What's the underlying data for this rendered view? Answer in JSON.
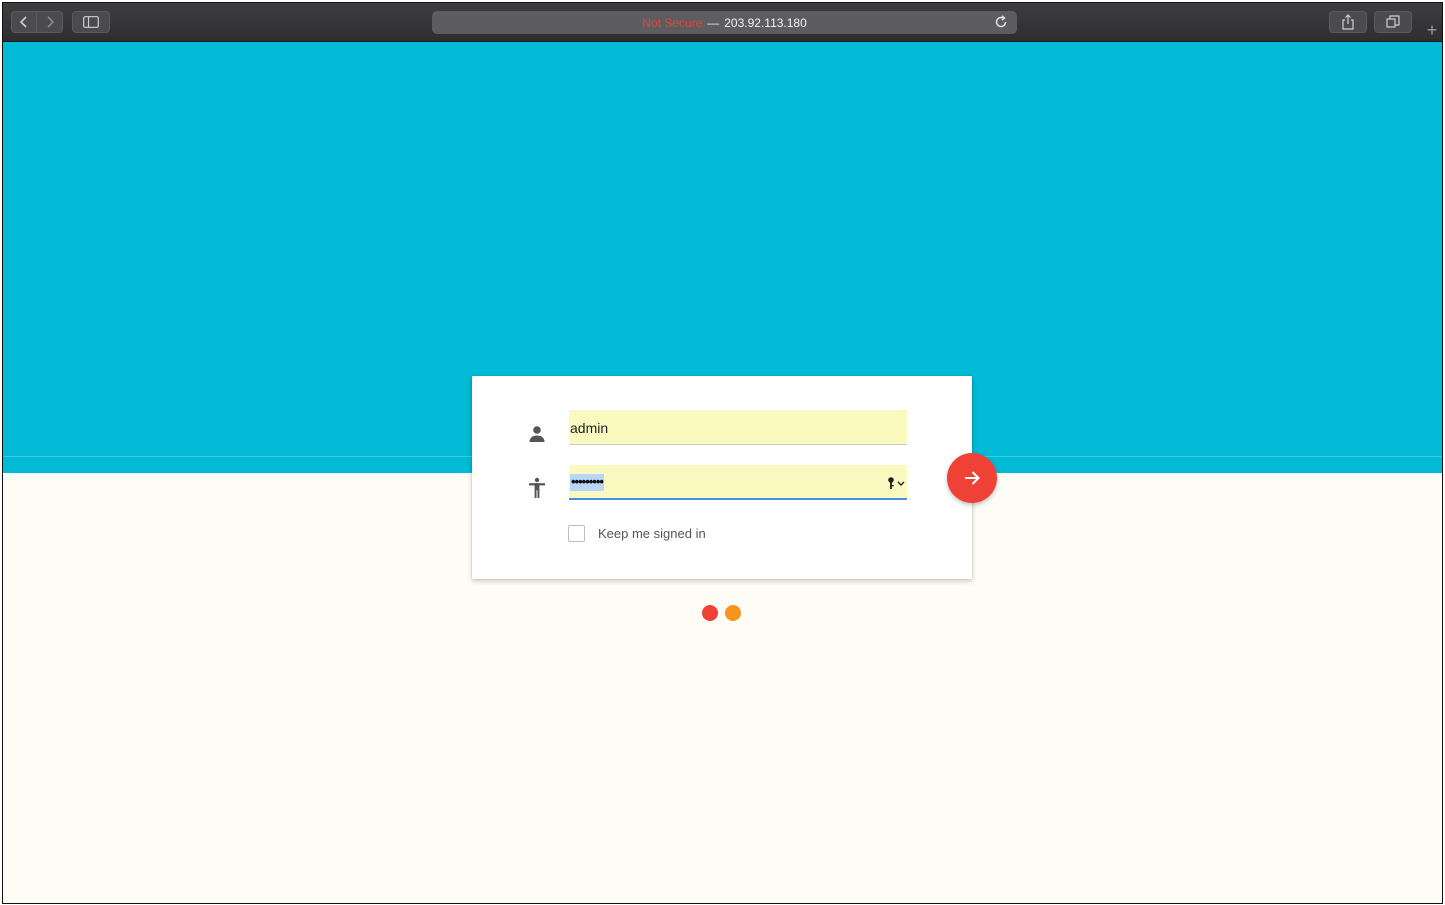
{
  "browser": {
    "url_insecure_label": "Not Secure",
    "url_separator": "—",
    "url_host": "203.92.113.180",
    "newtab_glyph": "+",
    "icons": [
      "back-icon",
      "forward-icon",
      "sidebar-icon",
      "reload-icon",
      "share-icon",
      "tabs-icon"
    ]
  },
  "login": {
    "username_value": "admin",
    "password_masked": "•••••••••",
    "remember_label": "Keep me signed in",
    "remember_checked": false,
    "icons": [
      "person-icon",
      "accessibility-icon",
      "key-icon",
      "arrow-right-icon"
    ]
  },
  "colors": {
    "hero": "#00bad6",
    "page_background": "#fefdf5",
    "submit_button": "#ef4136",
    "autofill_field": "#fafac0",
    "dot_1": "#ef4136",
    "dot_2": "#f7941d"
  }
}
